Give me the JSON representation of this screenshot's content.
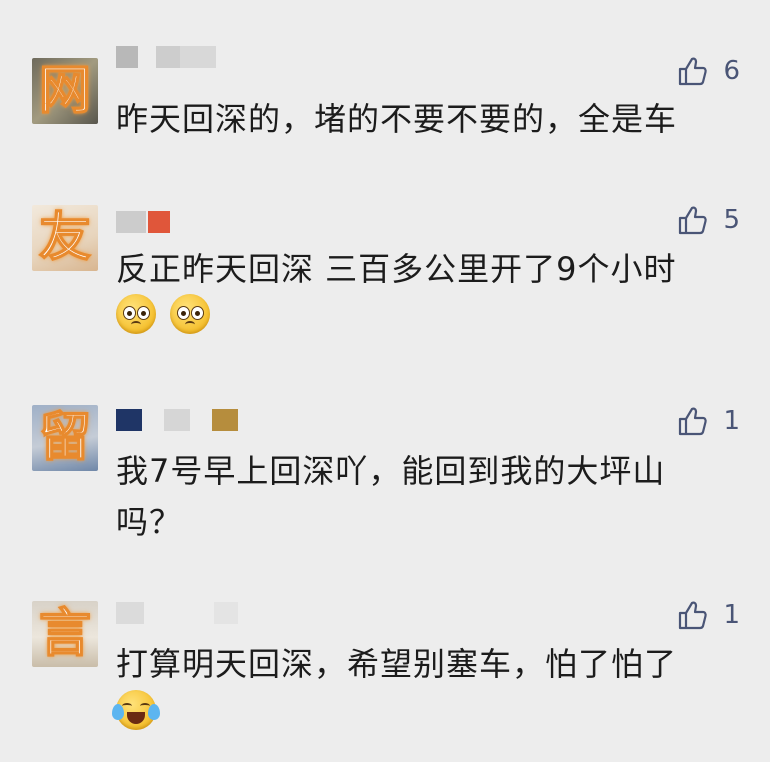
{
  "comments": [
    {
      "avatar_glyph": "网",
      "likes": "6",
      "text": "昨天回深的，堵的不要不要的，全是车",
      "emoji": []
    },
    {
      "avatar_glyph": "友",
      "likes": "5",
      "text": "反正昨天回深 三百多公里开了9个小时",
      "emoji": [
        "pleading-face",
        "pleading-face"
      ]
    },
    {
      "avatar_glyph": "留",
      "likes": "1",
      "text": "我7号早上回深吖，能回到我的大坪山吗？",
      "emoji": []
    },
    {
      "avatar_glyph": "言",
      "likes": "1",
      "text": "打算明天回深，希望别塞车，怕了怕了",
      "emoji": [
        "tears-of-joy-face"
      ]
    }
  ],
  "colors": {
    "background": "#ededed",
    "text": "#1c1c1c",
    "like_icon": "#4a5576",
    "glyph_outline": "#e88a2e"
  },
  "icons": {
    "like": "thumbs-up-icon"
  }
}
